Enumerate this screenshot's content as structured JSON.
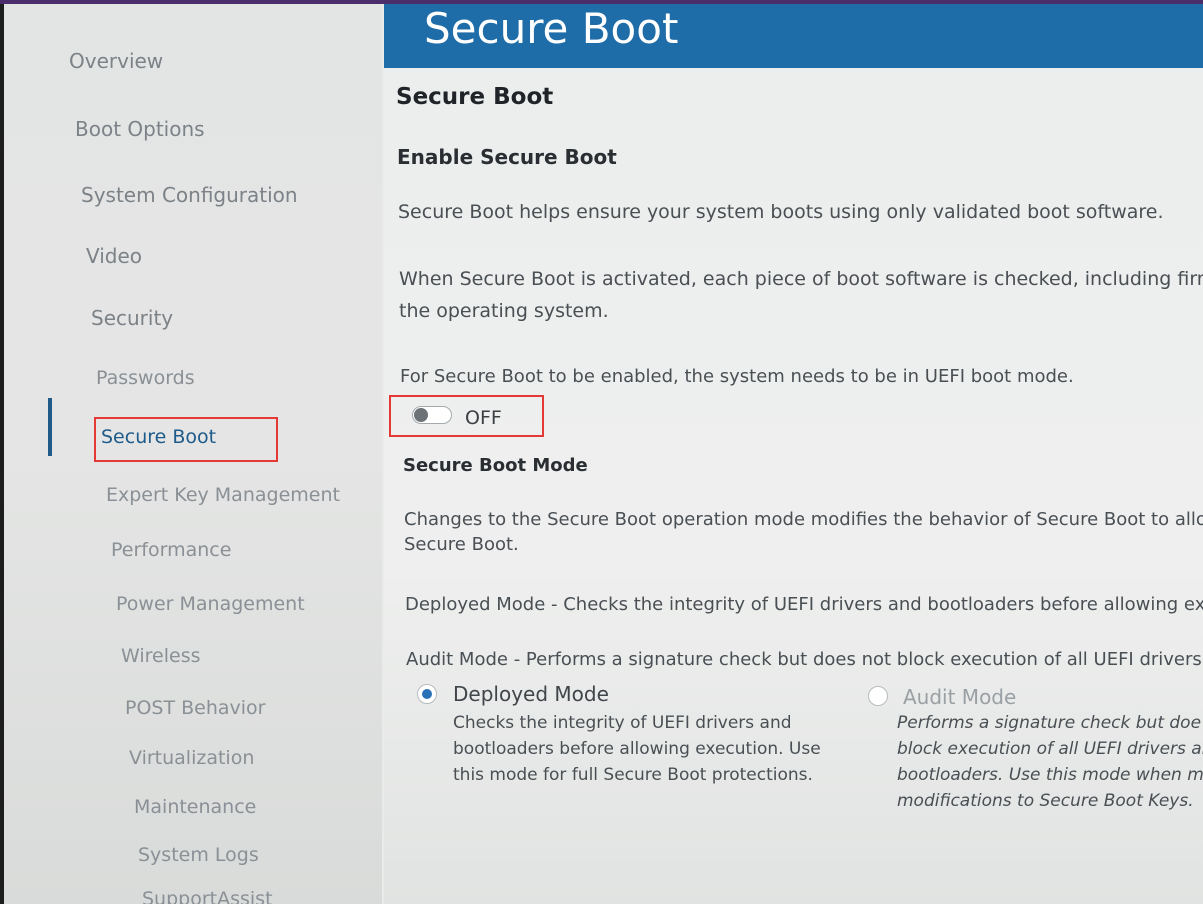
{
  "header": {
    "title": "Secure Boot"
  },
  "sidebar": {
    "items": [
      {
        "label": "Overview"
      },
      {
        "label": "Boot Options"
      },
      {
        "label": "System Configuration"
      },
      {
        "label": "Video"
      },
      {
        "label": "Security"
      },
      {
        "label": "Passwords"
      },
      {
        "label": "Secure Boot",
        "active": true
      },
      {
        "label": "Expert Key Management"
      },
      {
        "label": "Performance"
      },
      {
        "label": "Power Management"
      },
      {
        "label": "Wireless"
      },
      {
        "label": "POST Behavior"
      },
      {
        "label": "Virtualization"
      },
      {
        "label": "Maintenance"
      },
      {
        "label": "System Logs"
      },
      {
        "label": "SupportAssist"
      }
    ]
  },
  "content": {
    "section_title": "Secure Boot",
    "enable_heading": "Enable Secure Boot",
    "para1": "Secure Boot helps ensure your system boots using only validated boot software.",
    "para2_line1": "When Secure Boot is activated, each piece of boot software is checked, including firm",
    "para2_line2": "the operating system.",
    "para3": "For Secure Boot to be enabled, the system needs to be in UEFI boot mode.",
    "toggle": {
      "state_label": "OFF",
      "enabled": false
    },
    "mode_heading": "Secure Boot Mode",
    "mode_desc_line1": "Changes to the Secure Boot operation mode modifies the behavior of Secure Boot to allo",
    "mode_desc_line2": "Secure Boot.",
    "deployed_line": "Deployed Mode - Checks the integrity of UEFI drivers and bootloaders before allowing exec",
    "audit_line": "Audit Mode - Performs a signature check but does not block execution of all UEFI drivers ar",
    "options": [
      {
        "label": "Deployed Mode",
        "selected": true,
        "desc": [
          "Checks the integrity of UEFI drivers and",
          "bootloaders before allowing execution. Use",
          "this mode for full Secure Boot protections."
        ]
      },
      {
        "label": "Audit Mode",
        "selected": false,
        "desc": [
          "Performs a signature check but doe",
          "block execution of all UEFI drivers ar",
          "bootloaders.  Use this mode when m",
          "modifications to Secure Boot Keys."
        ]
      }
    ]
  },
  "colors": {
    "header_bg": "#1f6da8",
    "accent": "#1e5b8a",
    "radio_selected": "#2872b8",
    "highlight_box": "#e53935"
  }
}
